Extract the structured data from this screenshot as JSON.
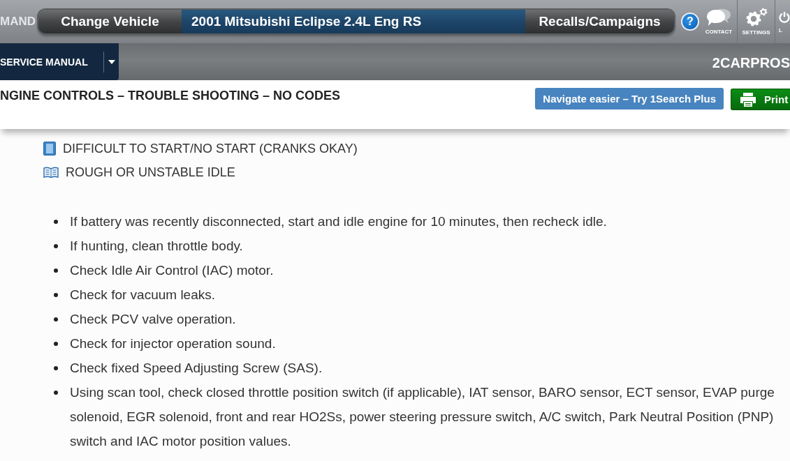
{
  "top_bar": {
    "logo": "MAND",
    "vehicle_bar": {
      "change_button": "Change Vehicle",
      "vehicle": "2001 Mitsubishi Eclipse 2.4L Eng RS",
      "recalls_button": "Recalls/Campaigns"
    },
    "actions": [
      {
        "kind": "help",
        "symbol": "?"
      },
      {
        "kind": "contact",
        "label": "CONTACT"
      },
      {
        "kind": "settings",
        "label": "SETTINGS"
      },
      {
        "kind": "logout",
        "label": "L"
      }
    ]
  },
  "sub_bar": {
    "menu_button": "SERVICE MANUAL",
    "brand": "2CARPROS"
  },
  "page_header": {
    "title": "NGINE CONTROLS – TROUBLE SHOOTING – NO CODES",
    "buttons": [
      {
        "kind": "search",
        "label": "Navigate easier – Try 1Search Plus"
      },
      {
        "kind": "print",
        "label": "Print"
      }
    ]
  },
  "links": [
    {
      "kind": "page",
      "label": "DIFFICULT TO START/NO START (CRANKS OKAY)"
    },
    {
      "kind": "book",
      "label": "ROUGH OR UNSTABLE IDLE"
    }
  ],
  "checklist": [
    "If battery was recently disconnected, start and idle engine for 10 minutes, then recheck idle.",
    "If hunting, clean throttle body.",
    "Check Idle Air Control (IAC) motor.",
    "Check for vacuum leaks.",
    "Check PCV valve operation.",
    "Check for injector operation sound.",
    "Check fixed Speed Adjusting Screw (SAS).",
    "Using scan tool, check closed throttle position switch (if applicable), IAT sensor, BARO sensor, ECT sensor, EVAP purge solenoid, EGR solenoid, front and rear HO2Ss, power steering pressure switch, A/C switch, Park Neutral Position (PNP) switch and IAC motor position values."
  ]
}
